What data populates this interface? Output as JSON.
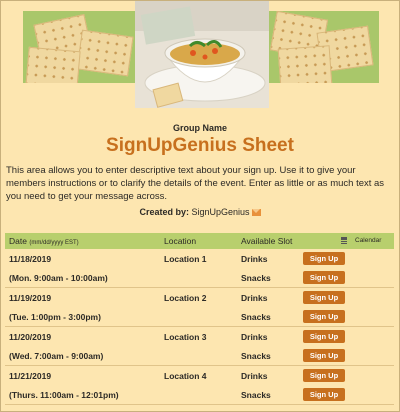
{
  "group_name": "Group Name",
  "sheet_title": "SignUpGenius Sheet",
  "description": "This area allows you to enter descriptive text about your sign up. Use it to give your members instructions or to clarify the details of the event. Enter as little or as much text as you need to get your message across.",
  "created_by": {
    "label": "Created by:",
    "name": "SignUpGenius",
    "icon": "mail-icon"
  },
  "colors": {
    "background": "#fde6b0",
    "header_bar": "#b8cf6d",
    "accent": "#c7701e"
  },
  "table": {
    "headers": {
      "date": "Date",
      "date_format": "(mm/dd/yyyy EST)",
      "location": "Location",
      "slot": "Available Slot",
      "calendar": "Calendar"
    },
    "signup_label": "Sign Up",
    "events": [
      {
        "date": "11/18/2019",
        "time": "(Mon. 9:00am - 10:00am)",
        "location": "Location 1",
        "slots": [
          "Drinks",
          "Snacks"
        ]
      },
      {
        "date": "11/19/2019",
        "time": "(Tue. 1:00pm - 3:00pm)",
        "location": "Location 2",
        "slots": [
          "Drinks",
          "Snacks"
        ]
      },
      {
        "date": "11/20/2019",
        "time": "(Wed. 7:00am - 9:00am)",
        "location": "Location 3",
        "slots": [
          "Drinks",
          "Snacks"
        ]
      },
      {
        "date": "11/21/2019",
        "time": "(Thurs. 11:00am - 12:01pm)",
        "location": "Location 4",
        "slots": [
          "Drinks",
          "Snacks"
        ]
      }
    ]
  }
}
